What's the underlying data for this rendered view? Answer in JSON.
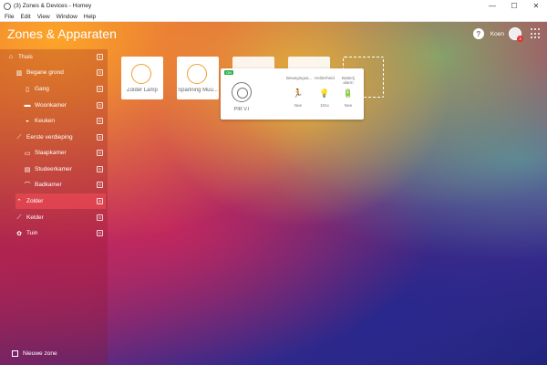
{
  "window": {
    "title": "(3) Zones & Devices - Homey",
    "controls": {
      "minimize": "—",
      "maximize": "☐",
      "close": "✕"
    }
  },
  "menubar": [
    "File",
    "Edit",
    "View",
    "Window",
    "Help"
  ],
  "header": {
    "title": "Zones & Apparaten",
    "help_label": "?",
    "user_name": "Koen",
    "notification_count": "3"
  },
  "sidebar": {
    "zones": [
      {
        "label": "Thuis",
        "count": "1",
        "icon": "home-icon",
        "glyph": "⌂"
      },
      {
        "label": "Begane grond",
        "count": "0",
        "icon": "floor-icon",
        "glyph": "▥"
      },
      {
        "label": "Gang",
        "count": "0",
        "icon": "door-icon",
        "glyph": "▯"
      },
      {
        "label": "Woonkamer",
        "count": "0",
        "icon": "sofa-icon",
        "glyph": "▬"
      },
      {
        "label": "Keuken",
        "count": "0",
        "icon": "kitchen-icon",
        "glyph": "◒"
      },
      {
        "label": "Eerste verdieping",
        "count": "0",
        "icon": "stairs-icon",
        "glyph": "⟋"
      },
      {
        "label": "Slaapkamer",
        "count": "0",
        "icon": "bed-icon",
        "glyph": "▭"
      },
      {
        "label": "Studeerkamer",
        "count": "0",
        "icon": "desk-icon",
        "glyph": "▤"
      },
      {
        "label": "Badkamer",
        "count": "0",
        "icon": "shower-icon",
        "glyph": "⌒"
      },
      {
        "label": "Zolder",
        "count": "4",
        "icon": "attic-icon",
        "glyph": "⌃",
        "active": true
      },
      {
        "label": "Kelder",
        "count": "0",
        "icon": "basement-icon",
        "glyph": "⟋"
      },
      {
        "label": "Tuin",
        "count": "0",
        "icon": "garden-icon",
        "glyph": "✿"
      }
    ],
    "new_zone_label": "Nieuwe zone"
  },
  "devices": [
    {
      "label": "Zolder Lamp",
      "icon": "lamp-icon"
    },
    {
      "label": "Spanning Muu...",
      "icon": "plug-icon"
    }
  ],
  "popup": {
    "badge": "ON",
    "device_label": "PIR V.I",
    "capabilities": [
      {
        "name": "Bewegingsa...",
        "value": "Nee",
        "icon": "motion-icon",
        "glyph": "🏃"
      },
      {
        "name": "Helderheid",
        "value": "101x",
        "icon": "bulb-icon",
        "glyph": "💡"
      },
      {
        "name": "Batterij alarm",
        "value": "Nee",
        "icon": "battery-icon",
        "glyph": "🔋"
      }
    ]
  },
  "colors": {
    "active_zone": "#ff5060",
    "accent_orange": "#f0a030",
    "on_badge": "#2db34a"
  }
}
